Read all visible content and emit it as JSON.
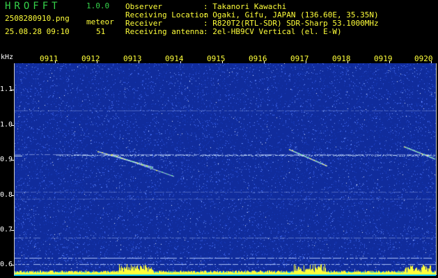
{
  "header": {
    "app_title": "HROFFT",
    "version": "1.0.0",
    "file_name": "2508280910.png",
    "timestamp": "25.08.28 09:10",
    "meteor_label": "meteor",
    "meteor_count": "51",
    "info": [
      {
        "label": "Observer",
        "value": ": Takanori Kawachi"
      },
      {
        "label": "Receiving Location",
        "value": ": Ogaki, Gifu, JAPAN (136.60E, 35.35N)"
      },
      {
        "label": "Receiver",
        "value": ": R820T2(RTL-SDR) SDR-Sharp 53.1000MHz"
      },
      {
        "label": "Receiving antenna",
        "value": ": 2el-HB9CV Vertical (el. E-W)"
      }
    ]
  },
  "spectrogram": {
    "y_unit": "kHz",
    "y_ticks": [
      "1.1",
      "1.0",
      "0.9",
      "0.8",
      "0.7",
      "0.6"
    ],
    "x_ticks": [
      "0911",
      "0912",
      "0913",
      "0914",
      "0915",
      "0916",
      "0917",
      "0918",
      "0919",
      "0920"
    ],
    "colors": {
      "background": "#102c9c",
      "noise_high": "#4a74ff",
      "trace": "#cfe8ff",
      "meteor": "#ffff40",
      "power_bar": "#ffff3a",
      "power_base": "#00c8ff"
    }
  }
}
